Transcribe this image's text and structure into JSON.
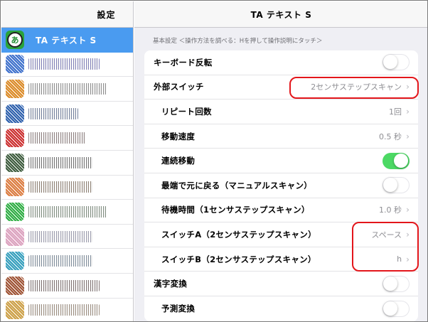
{
  "sidebar": {
    "title": "設定",
    "selected_item": {
      "label": "TA テキスト S",
      "icon": "ta-text-s-app-icon"
    },
    "blurred_items": [
      {
        "icon_color": "#3a6fd0",
        "text_color": "#6a6aaa",
        "text_width": 100
      },
      {
        "icon_color": "#e08a20",
        "text_color": "#7a7a7a",
        "text_width": 110
      },
      {
        "icon_color": "#2a5fb0",
        "text_color": "#5a6a8a",
        "text_width": 70
      },
      {
        "icon_color": "#d02a2a",
        "text_color": "#7a6a6a",
        "text_width": 80
      },
      {
        "icon_color": "#3a5a3a",
        "text_color": "#5a5a5a",
        "text_width": 90
      },
      {
        "icon_color": "#e07a3a",
        "text_color": "#7a6a5a",
        "text_width": 90
      },
      {
        "icon_color": "#2ab040",
        "text_color": "#6a7a6a",
        "text_width": 110
      },
      {
        "icon_color": "#e0a0c0",
        "text_color": "#8a8aa0",
        "text_width": 90
      },
      {
        "icon_color": "#30a0c0",
        "text_color": "#6a7a8a",
        "text_width": 90
      },
      {
        "icon_color": "#a05030",
        "text_color": "#6a5a5a",
        "text_width": 100
      },
      {
        "icon_color": "#d0a040",
        "text_color": "#8a7a6a",
        "text_width": 100
      }
    ]
  },
  "main": {
    "title": "TA テキスト S",
    "section_caption": "基本設定 ＜操作方法を調べる：Hを押して操作説明にタッチ＞",
    "rows": [
      {
        "label": "キーボード反転",
        "type": "toggle",
        "on": false
      },
      {
        "label": "外部スイッチ",
        "type": "value",
        "value": "2センサステップスキャン"
      },
      {
        "label": "リピート回数",
        "type": "value",
        "value": "1回"
      },
      {
        "label": "移動速度",
        "type": "value",
        "value": "0.5 秒"
      },
      {
        "label": "連続移動",
        "type": "toggle",
        "on": true
      },
      {
        "label": "最端で元に戻る（マニュアルスキャン）",
        "type": "toggle",
        "on": false
      },
      {
        "label": "待機時間（1センサステップスキャン）",
        "type": "value",
        "value": "1.0 秒"
      },
      {
        "label": "スイッチA（2センサステップスキャン）",
        "type": "value",
        "value": "スペース"
      },
      {
        "label": "スイッチB（2センサステップスキャン）",
        "type": "value",
        "value": "h"
      },
      {
        "label": "漢字変換",
        "type": "toggle",
        "on": false
      },
      {
        "label": "予測変換",
        "type": "toggle",
        "on": false
      }
    ]
  },
  "colors": {
    "accent": "#4a9bf0",
    "toggle_on": "#4cd964",
    "highlight": "#e3161b"
  }
}
